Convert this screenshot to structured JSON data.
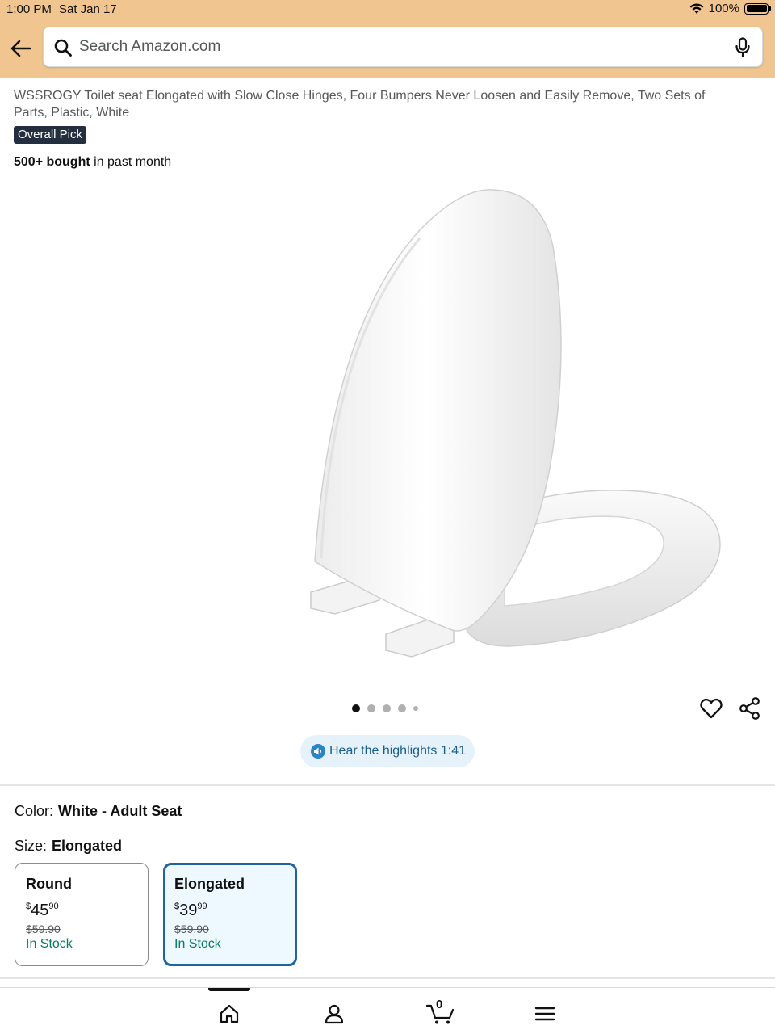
{
  "status": {
    "time": "1:00 PM",
    "date": "Sat Jan 17",
    "battery": "100%"
  },
  "search": {
    "placeholder": "Search Amazon.com"
  },
  "product": {
    "title": "WSSROGY Toilet seat Elongated with Slow Close Hinges, Four Bumpers Never Loosen and Easily Remove, Two Sets of Parts, Plastic, White",
    "badge": "Overall Pick",
    "bought_count": "500+ bought",
    "bought_suffix": " in past month",
    "image_dots": 5,
    "active_dot": 0
  },
  "highlights": {
    "label": "Hear the highlights 1:41"
  },
  "variants": {
    "color_label": "Color:",
    "color_value": "White - Adult Seat",
    "size_label": "Size:",
    "size_value": "Elongated",
    "options": [
      {
        "name": "Round",
        "currency": "$",
        "whole": "45",
        "fraction": "90",
        "list_price": "$59.90",
        "stock": "In Stock",
        "selected": false
      },
      {
        "name": "Elongated",
        "currency": "$",
        "whole": "39",
        "fraction": "99",
        "list_price": "$59.90",
        "stock": "In Stock",
        "selected": true
      }
    ]
  },
  "nav": {
    "cart_count": "0",
    "items": [
      "home-icon",
      "account-icon",
      "cart-icon",
      "menu-icon"
    ]
  },
  "colors": {
    "header_bg": "#f0c58f",
    "accent_blue": "#2162a1",
    "stock_green": "#067d62",
    "badge_bg": "#232f3e"
  }
}
